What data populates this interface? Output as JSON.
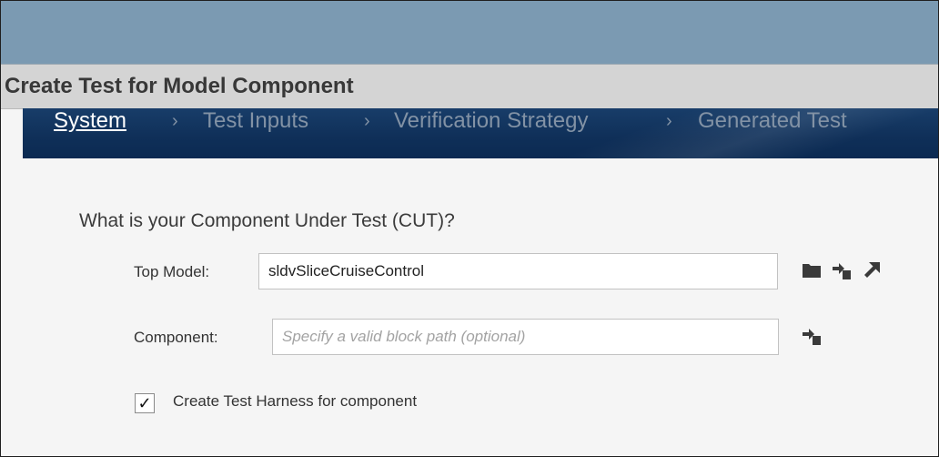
{
  "window": {
    "dialog_title": "Create Test for Model Component"
  },
  "stepper": {
    "steps": [
      {
        "label": "System",
        "active": true
      },
      {
        "label": "Test Inputs",
        "active": false
      },
      {
        "label": "Verification Strategy",
        "active": false
      },
      {
        "label": "Generated Test",
        "active": false
      }
    ],
    "separator": "›"
  },
  "form": {
    "question": "What is your Component Under Test (CUT)?",
    "top_model": {
      "label": "Top Model:",
      "value": "sldvSliceCruiseControl",
      "icons": [
        "folder-icon",
        "use-current-model-icon",
        "open-model-icon"
      ]
    },
    "component": {
      "label": "Component:",
      "value": "",
      "placeholder": "Specify a valid block path (optional)",
      "icons": [
        "use-current-block-icon"
      ]
    },
    "harness": {
      "label": "Create Test Harness for component",
      "checked": true,
      "check_glyph": "✓"
    }
  },
  "colors": {
    "titlebar": "#7b9ab2",
    "stepper_bg": "#0f2f58",
    "step_inactive": "#8292a5"
  }
}
